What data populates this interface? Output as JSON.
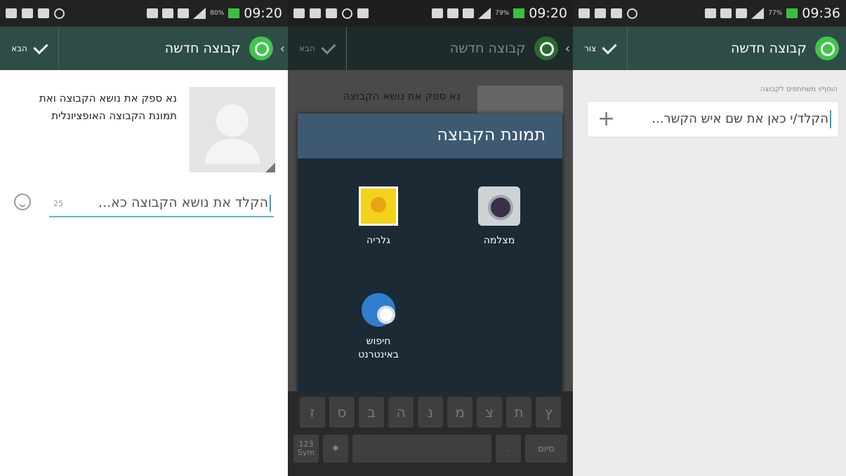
{
  "colors": {
    "actionbar": "#2e4d46",
    "dialog_header": "#3d5a72",
    "dialog_body": "#1b2a35",
    "whatsapp_green": "#3ec64a",
    "field_underline": "#5bb5d8"
  },
  "screens": [
    {
      "status": {
        "battery_pct": "80%",
        "time": "09:20"
      },
      "actionbar": {
        "title": "קבוצה חדשה",
        "done_label": "הבא",
        "icon": "whatsapp-icon",
        "back_icon": "chevron-left-icon"
      },
      "hint": "נא ספק את נושא הקבוצה ואת תמונת הקבוצה האופציונלית",
      "subject": {
        "placeholder": "הקלד את נושא הקבוצה כא...",
        "counter": "25"
      }
    },
    {
      "status": {
        "battery_pct": "79%",
        "time": "09:20"
      },
      "actionbar": {
        "title": "קבוצה חדשה",
        "done_label": "הבא"
      },
      "bg_hint": "נא ספק את נושא הקבוצה",
      "dialog": {
        "title": "תמונת הקבוצה",
        "options": [
          {
            "label": "מצלמה",
            "icon": "camera-icon"
          },
          {
            "label": "גלריה",
            "icon": "gallery-icon"
          },
          {
            "label": "חיפוש באינטרנט",
            "icon": "web-search-icon"
          }
        ]
      },
      "keyboard": {
        "row1": [
          "ץ",
          "ת",
          "צ",
          "מ",
          "נ",
          "ה",
          "ב",
          "ס",
          "ז"
        ],
        "sym_label": "123 Sym",
        "done_label": "סיום"
      }
    },
    {
      "status": {
        "battery_pct": "77%",
        "time": "09:36"
      },
      "actionbar": {
        "title": "קבוצה חדשה",
        "done_label": "צור",
        "icon": "whatsapp-icon"
      },
      "add_participants_label": "הוסף/י משתתפים לקבוצה",
      "contact_input": {
        "placeholder": "הקלד/י כאן את שם איש הקשר..."
      }
    }
  ]
}
